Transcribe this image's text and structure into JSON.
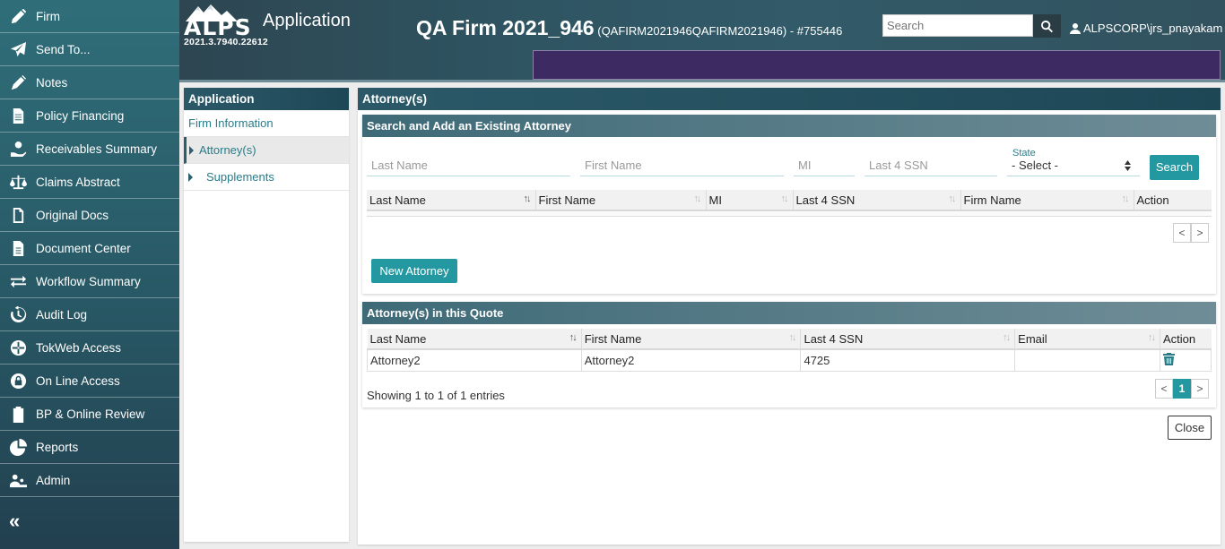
{
  "sidebar": {
    "items": [
      {
        "label": "Firm",
        "icon": "pencil-icon"
      },
      {
        "label": "Send To...",
        "icon": "paper-plane-icon"
      },
      {
        "label": "Notes",
        "icon": "pen-icon"
      },
      {
        "label": "Policy Financing",
        "icon": "document-icon"
      },
      {
        "label": "Receivables Summary",
        "icon": "hand-dollar-icon"
      },
      {
        "label": "Claims Abstract",
        "icon": "scale-icon"
      },
      {
        "label": "Original Docs",
        "icon": "file-icon"
      },
      {
        "label": "Document Center",
        "icon": "file-text-icon"
      },
      {
        "label": "Workflow Summary",
        "icon": "arrows-exchange-icon"
      },
      {
        "label": "Audit Log",
        "icon": "history-icon"
      },
      {
        "label": "TokWeb Access",
        "icon": "globe-icon"
      },
      {
        "label": "On Line Access",
        "icon": "lock-icon"
      },
      {
        "label": "BP & Online Review",
        "icon": "clipboard-dollar-icon"
      },
      {
        "label": "Reports",
        "icon": "pie-chart-icon"
      },
      {
        "label": "Admin",
        "icon": "users-cog-icon"
      }
    ],
    "collapse_label": "«"
  },
  "header": {
    "logo": "ALPS",
    "version": "2021.3.7940.22612",
    "app_title": "Application",
    "firm_name": "QA Firm 2021_946",
    "firm_detail": "(QAFIRM2021946QAFIRM2021946) - #755446",
    "search_placeholder": "Search",
    "user": "ALPSCORP\\jrs_pnayakam"
  },
  "left_panel": {
    "title": "Application",
    "items": [
      "Firm Information",
      "Attorney(s)",
      "Supplements"
    ]
  },
  "main": {
    "title": "Attorney(s)",
    "search_section": {
      "title": "Search and Add an Existing Attorney",
      "last_name_placeholder": "Last Name",
      "first_name_placeholder": "First Name",
      "mi_placeholder": "MI",
      "ssn_placeholder": "Last 4 SSN",
      "state_label": "State",
      "state_value": "- Select -",
      "search_button": "Search",
      "columns": [
        "Last Name",
        "First Name",
        "MI",
        "Last 4 SSN",
        "Firm Name",
        "Action"
      ],
      "pager": [
        "<",
        ">"
      ],
      "new_attorney_button": "New Attorney"
    },
    "quote_section": {
      "title": "Attorney(s) in this Quote",
      "columns": [
        "Last Name",
        "First Name",
        "Last 4 SSN",
        "Email",
        "Action"
      ],
      "rows": [
        {
          "last_name": "Attorney2",
          "first_name": "Attorney2",
          "ssn": "4725",
          "email": ""
        }
      ],
      "info": "Showing 1 to 1 of 1 entries",
      "pager": [
        "<",
        "1",
        ">"
      ]
    },
    "close_button": "Close"
  }
}
